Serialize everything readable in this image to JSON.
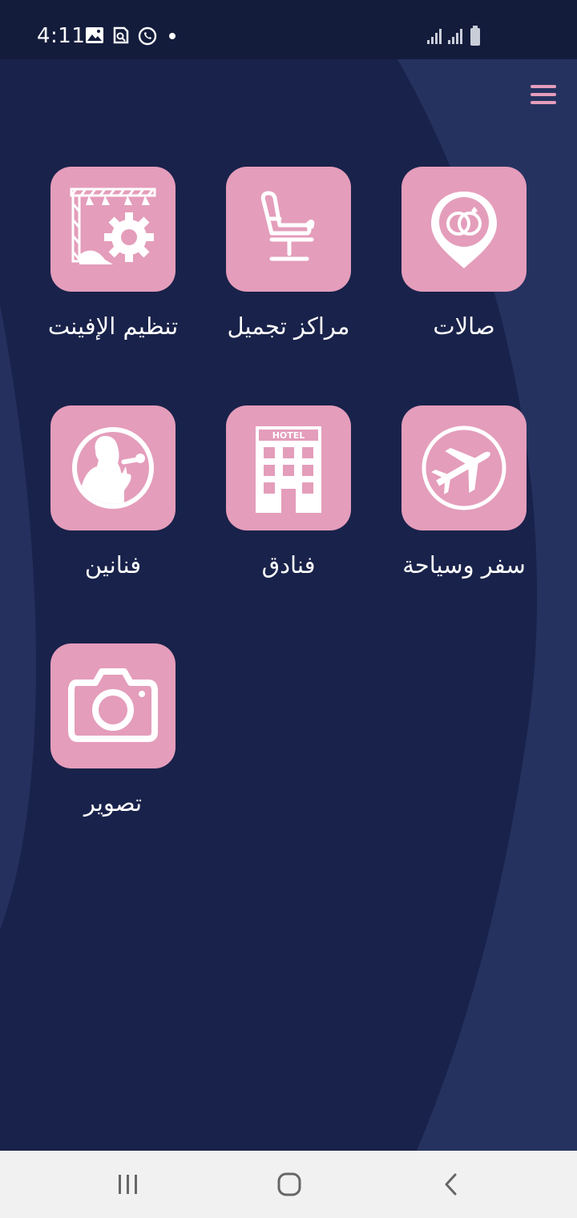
{
  "status_bar": {
    "time": "4:11",
    "icons": [
      "image-icon",
      "screen-search-icon",
      "whatsapp-icon",
      "notification-dot-icon",
      "signal-icon",
      "signal-icon",
      "battery-icon"
    ]
  },
  "header": {
    "menu_icon": "hamburger-menu-icon",
    "accent_color": "#e49dbb"
  },
  "categories": [
    {
      "label": "صالات",
      "icon": "wedding-rings-location-icon"
    },
    {
      "label": "مراكز تجميل",
      "icon": "salon-chair-icon"
    },
    {
      "label": "تنظيم الإفينت",
      "icon": "stage-settings-icon"
    },
    {
      "label": "سفر وسياحة",
      "icon": "airplane-icon"
    },
    {
      "label": "فنادق",
      "icon": "hotel-icon"
    },
    {
      "label": "فنانين",
      "icon": "singer-icon"
    },
    {
      "label": "تصوير",
      "icon": "camera-icon"
    }
  ],
  "colors": {
    "background": "#19224a",
    "tile": "#e49dbb",
    "label": "#ffffff",
    "nav_bar": "#f1f1f1"
  },
  "nav_bar": {
    "icons": [
      "recent-apps-icon",
      "home-icon",
      "back-icon"
    ]
  }
}
